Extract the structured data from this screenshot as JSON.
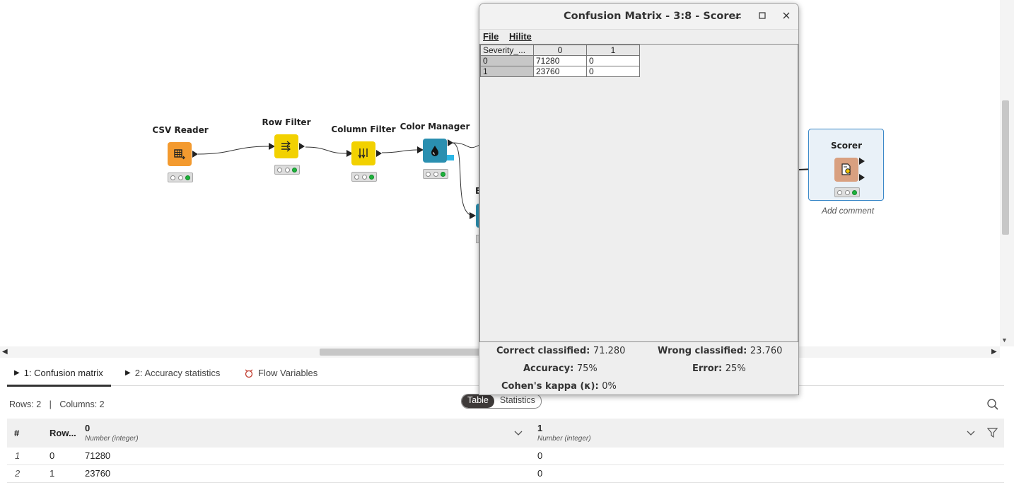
{
  "canvas": {
    "nodes": [
      {
        "title": "CSV Reader",
        "color": "#f39a2f"
      },
      {
        "title": "Row Filter",
        "color": "#f2d100"
      },
      {
        "title": "Column Filter",
        "color": "#f2d100"
      },
      {
        "title": "Color Manager",
        "color": "#2a8fb0"
      },
      {
        "title": "Ba",
        "color": "#2a8fb0"
      },
      {
        "title": "Scorer",
        "color": "#d9a080"
      }
    ],
    "scorer_comment": "Add comment"
  },
  "window": {
    "title": "Confusion Matrix - 3:8 - Scorer",
    "menu": [
      "File",
      "Hilite"
    ],
    "matrix": {
      "corner": "Severity_...",
      "columns": [
        "0",
        "1"
      ],
      "rows": [
        {
          "label": "0",
          "values": [
            "71280",
            "0"
          ]
        },
        {
          "label": "1",
          "values": [
            "23760",
            "0"
          ]
        }
      ]
    },
    "stats": {
      "correct_label": "Correct classified:",
      "correct_value": "71.280",
      "wrong_label": "Wrong classified:",
      "wrong_value": "23.760",
      "accuracy_label": "Accuracy:",
      "accuracy_value": "75%",
      "error_label": "Error:",
      "error_value": "25%",
      "kappa_label": "Cohen's kappa (κ):",
      "kappa_value": "0%"
    }
  },
  "bottom": {
    "tabs": [
      {
        "label": "1: Confusion matrix",
        "active": true
      },
      {
        "label": "2: Accuracy statistics",
        "active": false
      },
      {
        "label": "Flow Variables",
        "active": false
      }
    ],
    "rows_info": "Rows: 2",
    "cols_info": "Columns: 2",
    "toggle": [
      "Table",
      "Statistics"
    ],
    "table": {
      "headers": [
        {
          "name": "#",
          "type": ""
        },
        {
          "name": "Row...",
          "type": ""
        },
        {
          "name": "0",
          "type": "Number (integer)"
        },
        {
          "name": "1",
          "type": "Number (integer)"
        }
      ],
      "rows": [
        [
          "1",
          "0",
          "71280",
          "0"
        ],
        [
          "2",
          "1",
          "23760",
          "0"
        ]
      ]
    }
  }
}
